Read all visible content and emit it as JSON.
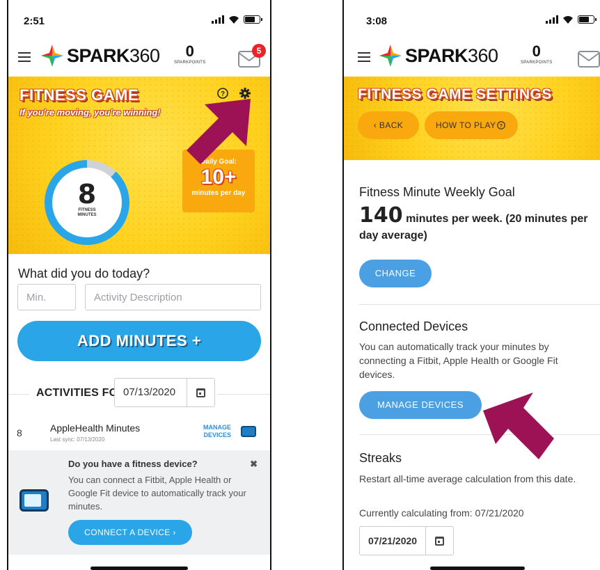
{
  "left": {
    "status": {
      "time": "2:51"
    },
    "header": {
      "brand_bold": "SPARK",
      "brand_num": "360",
      "points": "0",
      "points_label": "SPARKPOINTS",
      "unread": "5"
    },
    "banner": {
      "title": "FITNESS GAME",
      "subtitle": "If you're moving, you're winning!"
    },
    "progress": {
      "minutes": "8",
      "label_line1": "FITNESS",
      "label_line2": "MINUTES",
      "fraction": 0.88
    },
    "goal": {
      "label": "Daily Goal:",
      "value": "10+",
      "unit": "minutes per day"
    },
    "form": {
      "question": "What did you do today?",
      "min_placeholder": "Min.",
      "desc_placeholder": "Activity Description",
      "add_label": "ADD MINUTES +"
    },
    "activities": {
      "heading": "ACTIVITIES FOR",
      "date": "07/13/2020"
    },
    "activity_row": {
      "minutes": "8",
      "title": "AppleHealth Minutes",
      "sub": "Last sync: 07/13/2020",
      "manage_line1": "MANAGE",
      "manage_line2": "DEVICES"
    },
    "promo": {
      "title": "Do you have a fitness device?",
      "close": "✖",
      "text": "You can connect a Fitbit, Apple Health or Google Fit device to automatically track your minutes.",
      "button": "CONNECT A DEVICE  ›"
    }
  },
  "right": {
    "status": {
      "time": "3:08"
    },
    "header": {
      "brand_bold": "SPARK",
      "brand_num": "360",
      "points": "0",
      "points_label": "SPARKPOINTS"
    },
    "banner": {
      "title": "FITNESS GAME SETTINGS",
      "back": "‹  BACK",
      "how_to": "HOW TO PLAY"
    },
    "weekly": {
      "heading": "Fitness Minute Weekly Goal",
      "value": "140",
      "text": " minutes per week. (20 minutes per day average)",
      "button": "CHANGE"
    },
    "devices": {
      "heading": "Connected Devices",
      "text": "You can automatically track your minutes by connecting a Fitbit, Apple Health or Google Fit devices.",
      "button": "MANAGE DEVICES"
    },
    "streaks": {
      "heading": "Streaks",
      "text": "Restart all-time average calculation from this date.",
      "current": "Currently calculating from: 07/21/2020",
      "date": "07/21/2020"
    }
  },
  "colors": {
    "accent_blue": "#2aa6e8",
    "banner_yellow": "#ffd21f",
    "goal_orange": "#f9a80e",
    "arrow_maroon": "#9c1254",
    "badge_red": "#e8242b"
  }
}
